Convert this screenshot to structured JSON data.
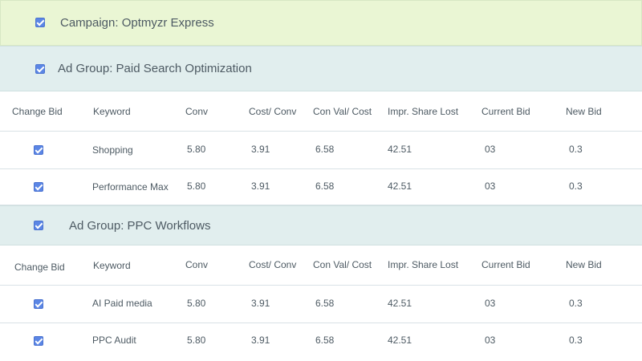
{
  "campaign": {
    "label": "Campaign: Optmyzr Express",
    "checked": true
  },
  "columns": [
    "Change Bid",
    "Keyword",
    "Conv",
    "Cost/ Conv",
    "Con Val/ Cost",
    "Impr. Share Lost",
    "Current Bid",
    "New Bid"
  ],
  "ad_groups": [
    {
      "label": "Ad Group: Paid Search Optimization",
      "checked": true,
      "rows": [
        {
          "checked": true,
          "keyword": "Shopping",
          "conv": "5.80",
          "cost_conv": "3.91",
          "con_val_cost": "6.58",
          "impr_share_lost": "42.51",
          "current_bid": "03",
          "new_bid": "0.3"
        },
        {
          "checked": true,
          "keyword": "Performance Max",
          "conv": "5.80",
          "cost_conv": "3.91",
          "con_val_cost": "6.58",
          "impr_share_lost": "42.51",
          "current_bid": "03",
          "new_bid": "0.3"
        }
      ]
    },
    {
      "label": "Ad Group: PPC Workflows",
      "checked": true,
      "rows": [
        {
          "checked": true,
          "keyword": "AI Paid media",
          "conv": "5.80",
          "cost_conv": "3.91",
          "con_val_cost": "6.58",
          "impr_share_lost": "42.51",
          "current_bid": "03",
          "new_bid": "0.3"
        },
        {
          "checked": true,
          "keyword": "PPC Audit",
          "conv": "5.80",
          "cost_conv": "3.91",
          "con_val_cost": "6.58",
          "impr_share_lost": "42.51",
          "current_bid": "03",
          "new_bid": "0.3"
        }
      ]
    }
  ],
  "colors": {
    "checkbox": "#5b86e5",
    "campaign_band": "#eaf6d4",
    "group_band": "#e1eeee",
    "text": "#4d5a63",
    "divider": "#d9e2e6"
  }
}
